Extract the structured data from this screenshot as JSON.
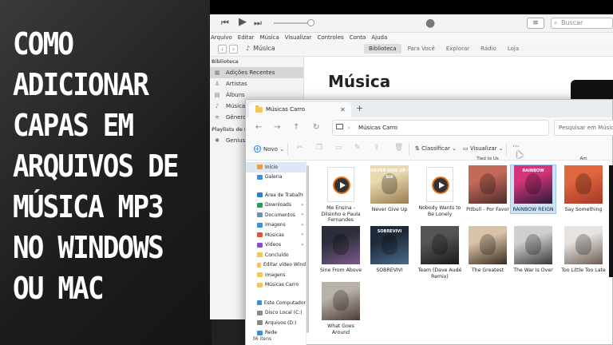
{
  "headline": [
    "COMO",
    "ADICIONAR",
    "CAPAS EM",
    "ARQUIVOS DE",
    "MÚSICA MP3",
    "NO WINDOWS",
    "OU MAC"
  ],
  "itunes": {
    "controls": {
      "prev": "⏮",
      "play": "▶",
      "next": "⏭"
    },
    "search_placeholder": "Buscar",
    "menu": [
      "Arquivo",
      "Editar",
      "Música",
      "Visualizar",
      "Controles",
      "Conta",
      "Ajuda"
    ],
    "nav_section": "Música",
    "tabs": [
      {
        "label": "Biblioteca",
        "active": true
      },
      {
        "label": "Para Você",
        "active": false
      },
      {
        "label": "Explorar",
        "active": false
      },
      {
        "label": "Rádio",
        "active": false
      },
      {
        "label": "Loja",
        "active": false
      }
    ],
    "library_header": "Biblioteca",
    "library_items": [
      {
        "label": "Adições Recentes",
        "icon": "clock-icon",
        "glyph": "▦",
        "selected": true
      },
      {
        "label": "Artistas",
        "icon": "mic-icon",
        "glyph": "♙",
        "selected": false
      },
      {
        "label": "Álbuns",
        "icon": "album-icon",
        "glyph": "▤",
        "selected": false
      },
      {
        "label": "Músicas",
        "icon": "note-icon",
        "glyph": "♪",
        "selected": false
      },
      {
        "label": "Gêneros",
        "icon": "genre-icon",
        "glyph": "≋",
        "selected": false
      }
    ],
    "playlists_header": "Playlists de Músic",
    "playlist_items": [
      {
        "label": "Genius",
        "icon": "genius-icon",
        "glyph": "✺"
      }
    ],
    "main_heading": "Música"
  },
  "explorer": {
    "tab_title": "Músicas Carro",
    "address": "Músicas Carro",
    "search_placeholder": "Pesquisar em Músicas",
    "commands": {
      "new": "Novo",
      "sort": "Classificar",
      "view": "Visualizar",
      "more": "···"
    },
    "nav_items": [
      {
        "label": "Início",
        "color": "#e3a33b",
        "selected": true,
        "pinned": false
      },
      {
        "label": "Galeria",
        "color": "#3a8fd8",
        "selected": false,
        "pinned": false
      },
      {
        "gap": true
      },
      {
        "label": "Área de Trabalh",
        "color": "#2f7fd1",
        "selected": false,
        "pinned": true
      },
      {
        "label": "Downloads",
        "color": "#2e9a55",
        "selected": false,
        "pinned": true
      },
      {
        "label": "Documentos",
        "color": "#6d8fb3",
        "selected": false,
        "pinned": true
      },
      {
        "label": "Imagens",
        "color": "#3a8fd8",
        "selected": false,
        "pinned": true
      },
      {
        "label": "Músicas",
        "color": "#e0533d",
        "selected": false,
        "pinned": true
      },
      {
        "label": "Vídeos",
        "color": "#8b4fc9",
        "selected": false,
        "pinned": true
      },
      {
        "label": "Concluído",
        "color": "#f4c65a",
        "selected": false,
        "pinned": false
      },
      {
        "label": "Editar vídeo Wind",
        "color": "#f4c65a",
        "selected": false,
        "pinned": false
      },
      {
        "label": "imagens",
        "color": "#f4c65a",
        "selected": false,
        "pinned": false
      },
      {
        "label": "Músicas Carro",
        "color": "#f4c65a",
        "selected": false,
        "pinned": false
      },
      {
        "gap": true
      },
      {
        "label": "Este Computador",
        "color": "#3a8fd8",
        "selected": false,
        "pinned": false
      },
      {
        "label": "Disco Local (C:)",
        "color": "#888888",
        "selected": false,
        "pinned": false
      },
      {
        "label": "Arquivos (D:)",
        "color": "#888888",
        "selected": false,
        "pinned": false
      },
      {
        "label": "Rede",
        "color": "#3a8fd8",
        "selected": false,
        "pinned": false
      }
    ],
    "status": "36 itens",
    "top_partial_labels": [
      "",
      "",
      "",
      "Tied to Us",
      "",
      "Am",
      ""
    ],
    "items": [
      {
        "label": "Me Ensina - Dilsinho e Paula Fernandes",
        "kind": "file",
        "colors": []
      },
      {
        "label": "Never Give Up",
        "kind": "art",
        "colors": [
          "#e8d9b0",
          "#9a7b4f"
        ],
        "cover_text": "NEVER GIVE UP · SIA"
      },
      {
        "label": "Nobody Wants to Be Lonely",
        "kind": "file",
        "colors": []
      },
      {
        "label": "Pitbull - Por Favor",
        "kind": "art",
        "colors": [
          "#c46a58",
          "#4b2c2a"
        ]
      },
      {
        "label": "RAINBOW REIGN",
        "kind": "art",
        "colors": [
          "#d2357a",
          "#2b1a3a"
        ],
        "selected": true,
        "cover_text": "RAINBOW"
      },
      {
        "label": "Say Something",
        "kind": "art",
        "colors": [
          "#e0663d",
          "#a33a2a"
        ]
      },
      {
        "label": "Sine From Above",
        "kind": "art",
        "colors": [
          "#2b2e3a",
          "#7b5a8a"
        ]
      },
      {
        "label": "SOBREVIVI",
        "kind": "art",
        "colors": [
          "#1e2a3a",
          "#4a6a8a"
        ],
        "cover_text": "SOBREVIVI"
      },
      {
        "label": "Team (Dave Audé Remix)",
        "kind": "art",
        "colors": [
          "#555555",
          "#1a1a1a"
        ]
      },
      {
        "label": "The Greatest",
        "kind": "art",
        "colors": [
          "#d8c3a8",
          "#3a2a20"
        ]
      },
      {
        "label": "The War Is Over",
        "kind": "art",
        "colors": [
          "#cfcfcf",
          "#3a3a3a"
        ]
      },
      {
        "label": "Too Little Too Late",
        "kind": "art",
        "colors": [
          "#e8e3de",
          "#6b5b55"
        ]
      },
      {
        "label": "What Goes Around",
        "kind": "art",
        "colors": [
          "#b9b2a8",
          "#4a3a35"
        ]
      }
    ]
  }
}
